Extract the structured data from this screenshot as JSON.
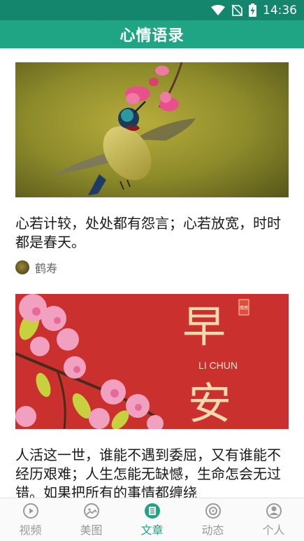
{
  "status_bar": {
    "time": "14:36",
    "icons": [
      "wifi-icon",
      "no-sim-icon",
      "battery-charging-icon"
    ]
  },
  "header": {
    "title": "心情语录"
  },
  "feed": {
    "cards": [
      {
        "image": "hummingbird-with-pink-blossoms",
        "quote": "心若计较，处处都有怨言；心若放宽，时时都是春天。",
        "author": "鹤寿"
      },
      {
        "image": "good-morning-cherry-blossoms",
        "image_text": {
          "big_top": "早",
          "small": "LI CHUN",
          "big_bottom": "安",
          "seal": "情感"
        },
        "quote": "人活这一世，谁能不遇到委屈，又有谁能不经历艰难；人生怎能无缺憾，生命怎会无过错。如果把所有的事情都缠绕"
      }
    ]
  },
  "tab_bar": {
    "items": [
      {
        "label": "视频",
        "icon": "video-play-icon",
        "active": false
      },
      {
        "label": "美图",
        "icon": "picture-icon",
        "active": false
      },
      {
        "label": "文章",
        "icon": "article-icon",
        "active": true
      },
      {
        "label": "动态",
        "icon": "moments-icon",
        "active": false
      },
      {
        "label": "个人",
        "icon": "person-icon",
        "active": false
      }
    ],
    "active_color": "#1fa583",
    "inactive_color": "#9a9a9a"
  }
}
